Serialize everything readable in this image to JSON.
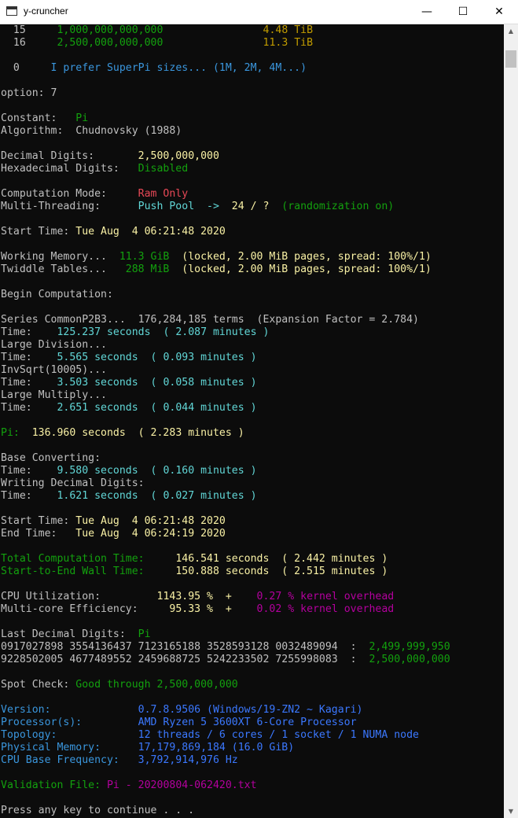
{
  "window": {
    "title": "y-cruncher",
    "minimize_glyph": "—",
    "maximize_glyph": "☐",
    "close_glyph": "✕",
    "app_icon": "console-window-icon"
  },
  "colors": {
    "background": "#0c0c0c",
    "default": "#c0c0c0",
    "green": "#13a10e",
    "teal": "#3a96dd",
    "cyan": "#61d6d6",
    "yellow": "#f9f1a5",
    "gold": "#c19c00",
    "red": "#e74856",
    "magenta": "#b4009e",
    "blue": "#3b78ff"
  },
  "lines": [
    [
      [
        "  15     ",
        "default"
      ],
      [
        "1,000,000,000,000",
        "green"
      ],
      [
        "                ",
        "default"
      ],
      [
        "4.48 TiB",
        "gold"
      ]
    ],
    [
      [
        "  16     ",
        "default"
      ],
      [
        "2,500,000,000,000",
        "green"
      ],
      [
        "                ",
        "default"
      ],
      [
        "11.3 TiB",
        "gold"
      ]
    ],
    [],
    [
      [
        "  0     ",
        "default"
      ],
      [
        "I prefer SuperPi sizes... (1M, 2M, 4M...)",
        "teal"
      ]
    ],
    [],
    [
      [
        "option: 7",
        "default"
      ]
    ],
    [],
    [
      [
        "Constant:   ",
        "default"
      ],
      [
        "Pi",
        "green"
      ]
    ],
    [
      [
        "Algorithm:  Chudnovsky (1988)",
        "default"
      ]
    ],
    [],
    [
      [
        "Decimal Digits:       ",
        "default"
      ],
      [
        "2,500,000,000",
        "yellow"
      ]
    ],
    [
      [
        "Hexadecimal Digits:   ",
        "default"
      ],
      [
        "Disabled",
        "green"
      ]
    ],
    [],
    [
      [
        "Computation Mode:     ",
        "default"
      ],
      [
        "Ram Only",
        "red"
      ]
    ],
    [
      [
        "Multi-Threading:      ",
        "default"
      ],
      [
        "Push Pool  ->  ",
        "cyan"
      ],
      [
        "24 / ?",
        "yellow"
      ],
      [
        "  (randomization on)",
        "green"
      ]
    ],
    [],
    [
      [
        "Start Time: ",
        "default"
      ],
      [
        "Tue Aug  4 06:21:48 2020",
        "yellow"
      ]
    ],
    [],
    [
      [
        "Working Memory...  ",
        "default"
      ],
      [
        "11.3 GiB",
        "green"
      ],
      [
        "  (locked, 2.00 MiB pages, spread: 100%/1)",
        "yellow"
      ]
    ],
    [
      [
        "Twiddle Tables...   ",
        "default"
      ],
      [
        "288 MiB",
        "green"
      ],
      [
        "  (locked, 2.00 MiB pages, spread: 100%/1)",
        "yellow"
      ]
    ],
    [],
    [
      [
        "Begin Computation:",
        "default"
      ]
    ],
    [],
    [
      [
        "Series CommonP2B3...  176,284,185 terms  (Expansion Factor = 2.784)",
        "default"
      ]
    ],
    [
      [
        "Time:    ",
        "default"
      ],
      [
        "125.237 seconds  ( 2.087 minutes )",
        "cyan"
      ]
    ],
    [
      [
        "Large Division...",
        "default"
      ]
    ],
    [
      [
        "Time:    ",
        "default"
      ],
      [
        "5.565 seconds  ( 0.093 minutes )",
        "cyan"
      ]
    ],
    [
      [
        "InvSqrt(10005)...",
        "default"
      ]
    ],
    [
      [
        "Time:    ",
        "default"
      ],
      [
        "3.503 seconds  ( 0.058 minutes )",
        "cyan"
      ]
    ],
    [
      [
        "Large Multiply...",
        "default"
      ]
    ],
    [
      [
        "Time:    ",
        "default"
      ],
      [
        "2.651 seconds  ( 0.044 minutes )",
        "cyan"
      ]
    ],
    [],
    [
      [
        "Pi:  ",
        "green"
      ],
      [
        "136.960 seconds  ( 2.283 minutes )",
        "yellow"
      ]
    ],
    [],
    [
      [
        "Base Converting:",
        "default"
      ]
    ],
    [
      [
        "Time:    ",
        "default"
      ],
      [
        "9.580 seconds  ( 0.160 minutes )",
        "cyan"
      ]
    ],
    [
      [
        "Writing Decimal Digits:",
        "default"
      ]
    ],
    [
      [
        "Time:    ",
        "default"
      ],
      [
        "1.621 seconds  ( 0.027 minutes )",
        "cyan"
      ]
    ],
    [],
    [
      [
        "Start Time: ",
        "default"
      ],
      [
        "Tue Aug  4 06:21:48 2020",
        "yellow"
      ]
    ],
    [
      [
        "End Time:   ",
        "default"
      ],
      [
        "Tue Aug  4 06:24:19 2020",
        "yellow"
      ]
    ],
    [],
    [
      [
        "Total Computation Time:     ",
        "green"
      ],
      [
        "146.541 seconds  ( 2.442 minutes )",
        "yellow"
      ]
    ],
    [
      [
        "Start-to-End Wall Time:     ",
        "green"
      ],
      [
        "150.888 seconds  ( 2.515 minutes )",
        "yellow"
      ]
    ],
    [],
    [
      [
        "CPU Utilization:         ",
        "default"
      ],
      [
        "1143.95 %  +",
        "yellow"
      ],
      [
        "    ",
        "default"
      ],
      [
        "0.27 % kernel overhead",
        "magenta"
      ]
    ],
    [
      [
        "Multi-core Efficiency:     ",
        "default"
      ],
      [
        "95.33 %  +",
        "yellow"
      ],
      [
        "    ",
        "default"
      ],
      [
        "0.02 % kernel overhead",
        "magenta"
      ]
    ],
    [],
    [
      [
        "Last Decimal Digits:  ",
        "default"
      ],
      [
        "Pi",
        "green"
      ]
    ],
    [
      [
        "0917027898 3554136437 7123165188 3528593128 0032489094  :  ",
        "default"
      ],
      [
        "2,499,999,950",
        "green"
      ]
    ],
    [
      [
        "9228502005 4677489552 2459688725 5242233502 7255998083  :  ",
        "default"
      ],
      [
        "2,500,000,000",
        "green"
      ]
    ],
    [],
    [
      [
        "Spot Check: ",
        "default"
      ],
      [
        "Good through 2,500,000,000",
        "green"
      ]
    ],
    [],
    [
      [
        "Version:              ",
        "teal"
      ],
      [
        "0.7.8.9506 (Windows/19-ZN2 ~ Kagari)",
        "blue"
      ]
    ],
    [
      [
        "Processor(s):         ",
        "teal"
      ],
      [
        "AMD Ryzen 5 3600XT 6-Core Processor",
        "blue"
      ]
    ],
    [
      [
        "Topology:             ",
        "teal"
      ],
      [
        "12 threads / 6 cores / 1 socket / 1 NUMA node",
        "blue"
      ]
    ],
    [
      [
        "Physical Memory:      ",
        "teal"
      ],
      [
        "17,179,869,184 (16.0 GiB)",
        "blue"
      ]
    ],
    [
      [
        "CPU Base Frequency:   ",
        "teal"
      ],
      [
        "3,792,914,976 Hz",
        "blue"
      ]
    ],
    [],
    [
      [
        "Validation File: ",
        "green"
      ],
      [
        "Pi - 20200804-062420.txt",
        "magenta"
      ]
    ],
    [],
    [
      [
        "Press any key to continue . . .",
        "default"
      ]
    ]
  ],
  "scrollbar": {
    "up_glyph": "▲",
    "down_glyph": "▼"
  }
}
